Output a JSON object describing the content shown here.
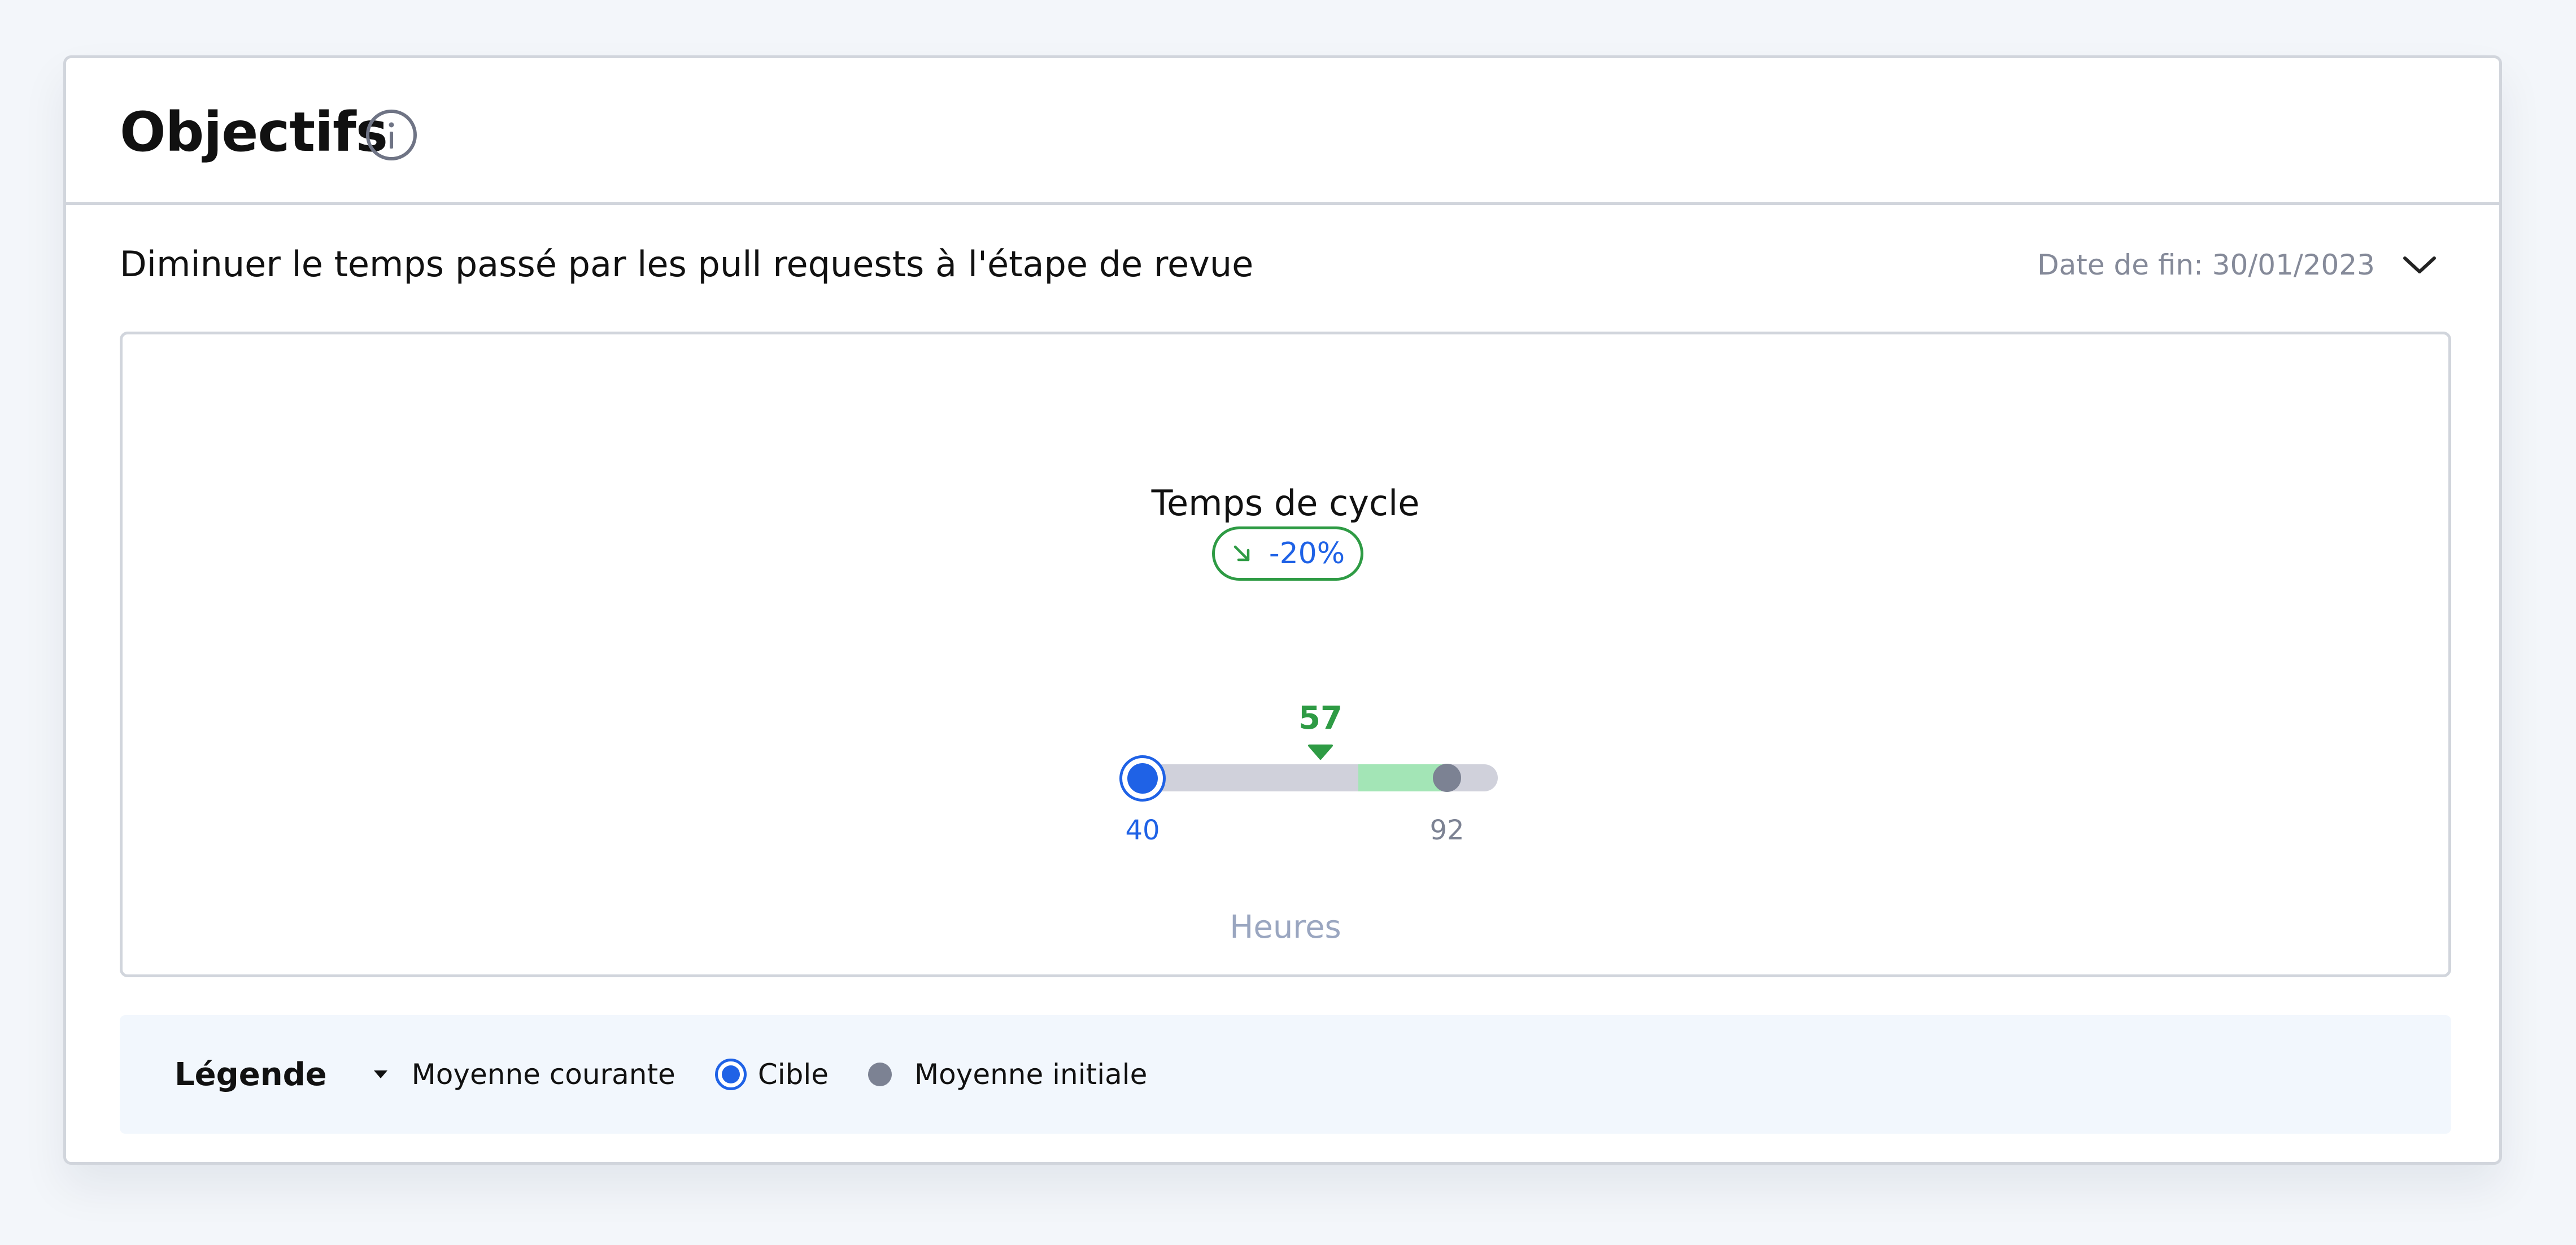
{
  "header": {
    "title": "Objectifs",
    "info_icon": "info-circle-icon"
  },
  "objective": {
    "title": "Diminuer le temps passé par les pull requests à l'étape de revue",
    "end_date_label": "Date de fin: 30/01/2023",
    "expand_icon": "chevron-down-icon"
  },
  "metric": {
    "title": "Temps de cycle",
    "change_icon": "arrow-down-right-icon",
    "change_label": "-20%",
    "current": 57,
    "current_label": "57",
    "target": 40,
    "target_label": "40",
    "initial": 92,
    "initial_label": "92",
    "unit_label": "Heures"
  },
  "legend": {
    "title": "Légende",
    "items": [
      {
        "label": "Moyenne courante",
        "icon": "triangle-down-icon"
      },
      {
        "label": "Cible",
        "icon": "target-dot-icon"
      },
      {
        "label": "Moyenne initiale",
        "icon": "gray-dot-icon"
      }
    ]
  },
  "colors": {
    "accent_blue": "#1f62e6",
    "success_green": "#2e9b44",
    "progress_green": "#a3e5b6",
    "track_gray": "#d0d1db",
    "initial_gray": "#7c8293",
    "muted_text": "#858a99"
  }
}
